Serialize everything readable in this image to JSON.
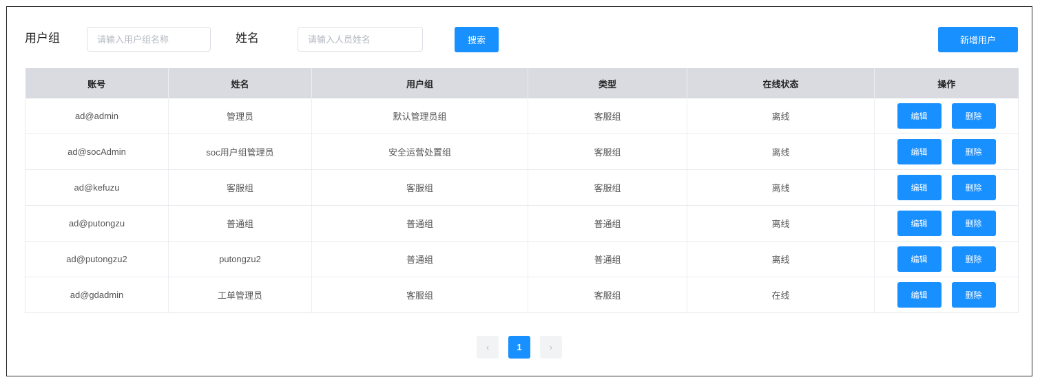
{
  "filters": {
    "group_label": "用户组",
    "group_placeholder": "请输入用户组名称",
    "name_label": "姓名",
    "name_placeholder": "请输入人员姓名",
    "search_button": "搜索",
    "add_button": "新增用户"
  },
  "table": {
    "columns": [
      "账号",
      "姓名",
      "用户组",
      "类型",
      "在线状态",
      "操作"
    ],
    "rows": [
      [
        "ad@admin",
        "管理员",
        "默认管理员组",
        "客服组",
        "离线"
      ],
      [
        "ad@socAdmin",
        "soc用户组管理员",
        "安全运营处置组",
        "客服组",
        "离线"
      ],
      [
        "ad@kefuzu",
        "客服组",
        "客服组",
        "客服组",
        "离线"
      ],
      [
        "ad@putongzu",
        "普通组",
        "普通组",
        "普通组",
        "离线"
      ],
      [
        "ad@putongzu2",
        "putongzu2",
        "普通组",
        "普通组",
        "离线"
      ],
      [
        "ad@gdadmin",
        "工单管理员",
        "客服组",
        "客服组",
        "在线"
      ]
    ],
    "edit_label": "编辑",
    "delete_label": "删除"
  },
  "pagination": {
    "prev_icon": "‹",
    "current_page": "1",
    "next_icon": "›"
  },
  "colors": {
    "primary": "#1890ff",
    "header_bg": "#d9dbe1"
  }
}
